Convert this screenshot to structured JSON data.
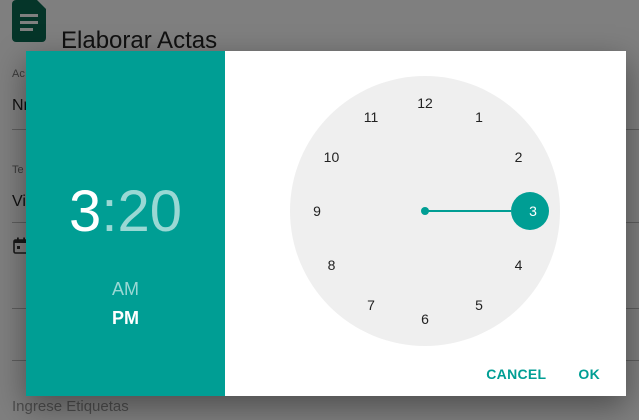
{
  "page": {
    "title": "Elaborar Actas",
    "fields": [
      {
        "label": "Ac",
        "value": "Nr"
      },
      {
        "label": "Te",
        "value": "Vi"
      }
    ],
    "tags_placeholder": "Ingrese Etiquetas"
  },
  "time_picker": {
    "hour": "3",
    "separator": ":",
    "minute": "20",
    "am_label": "AM",
    "pm_label": "PM",
    "selected_period": "PM",
    "clock_numbers": [
      "12",
      "1",
      "2",
      "3",
      "4",
      "5",
      "6",
      "7",
      "8",
      "9",
      "10",
      "11"
    ],
    "selected_number": "3",
    "cancel_label": "CANCEL",
    "ok_label": "OK"
  },
  "colors": {
    "accent": "#009e94",
    "dial": "#efefef"
  }
}
